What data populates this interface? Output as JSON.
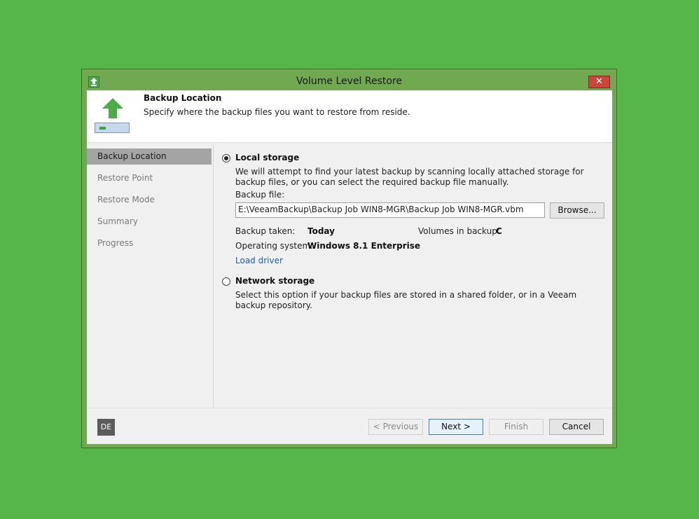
{
  "window": {
    "title": "Volume Level Restore",
    "close_symbol": "✕"
  },
  "header": {
    "title": "Backup Location",
    "description": "Specify where the backup files you want to restore from reside."
  },
  "steps": [
    {
      "label": "Backup Location",
      "active": true
    },
    {
      "label": "Restore Point",
      "active": false
    },
    {
      "label": "Restore Mode",
      "active": false
    },
    {
      "label": "Summary",
      "active": false
    },
    {
      "label": "Progress",
      "active": false
    }
  ],
  "local_storage": {
    "label": "Local storage",
    "selected": true,
    "description": "We will attempt to find your latest backup by scanning locally attached storage for backup files, or you can select the required backup file manually.",
    "backup_file_label": "Backup file:",
    "backup_file_value": "E:\\VeeamBackup\\Backup Job WIN8-MGR\\Backup Job WIN8-MGR.vbm",
    "browse_label": "Browse...",
    "backup_taken_label": "Backup taken:",
    "backup_taken_value": "Today",
    "volumes_label": "Volumes in backup:",
    "volumes_value": "C",
    "os_label": "Operating system:",
    "os_value": "Windows 8.1 Enterprise",
    "load_driver_label": "Load driver"
  },
  "network_storage": {
    "label": "Network storage",
    "selected": false,
    "description": "Select this option if your backup files are stored in a shared folder, or in a Veeam backup repository."
  },
  "footer": {
    "language_badge": "DE",
    "previous_label": "< Previous",
    "next_label": "Next >",
    "finish_label": "Finish",
    "cancel_label": "Cancel"
  },
  "colors": {
    "desktop": "#56b649",
    "window_frame": "#70a94f",
    "active_step": "#a4a4a4",
    "link": "#1a5fb4",
    "close_button": "#c9463b"
  },
  "icons": {
    "app": "upload-arrow-icon",
    "header": "restore-arrow-drive-icon",
    "close": "close-icon"
  }
}
